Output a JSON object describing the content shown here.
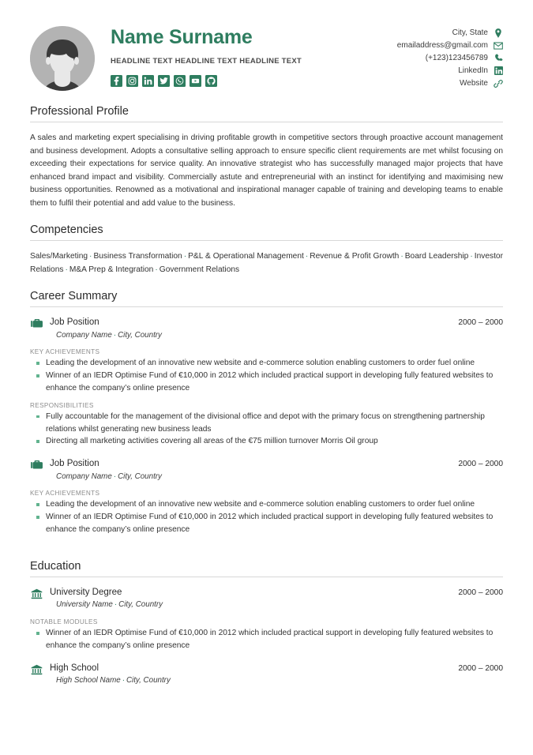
{
  "header": {
    "name": "Name Surname",
    "headline": "HEADLINE TEXT HEADLINE TEXT HEADLINE TEXT",
    "avatar_alt": "profile-photo-placeholder",
    "accent_color": "#2e7d5f",
    "socials": [
      {
        "name": "facebook-icon",
        "label": "Facebook"
      },
      {
        "name": "instagram-icon",
        "label": "Instagram"
      },
      {
        "name": "linkedin-icon",
        "label": "LinkedIn"
      },
      {
        "name": "twitter-icon",
        "label": "Twitter"
      },
      {
        "name": "whatsapp-icon",
        "label": "WhatsApp"
      },
      {
        "name": "youtube-icon",
        "label": "YouTube"
      },
      {
        "name": "github-icon",
        "label": "GitHub"
      }
    ],
    "contact": [
      {
        "text": "City, State",
        "icon": "map-pin-icon"
      },
      {
        "text": "emailaddress@gmail.com",
        "icon": "envelope-icon"
      },
      {
        "text": "(+123)123456789",
        "icon": "phone-icon"
      },
      {
        "text": "LinkedIn",
        "icon": "linkedin-icon"
      },
      {
        "text": "Website",
        "icon": "link-icon"
      }
    ]
  },
  "profile": {
    "title": "Professional Profile",
    "text": "A sales and marketing expert specialising in driving profitable growth in competitive sectors through proactive account management and business development. Adopts a consultative selling approach to ensure specific client requirements are met whilst focusing on exceeding their expectations for service quality. An innovative strategist who has successfully managed major projects that have enhanced brand impact and visibility. Commercially astute and entrepreneurial with an instinct for identifying and maximising new business opportunities. Renowned as a motivational and inspirational manager capable of training and developing teams to enable them to fulfil their potential and add value to the business."
  },
  "competencies": {
    "title": "Competencies",
    "items": [
      "Sales/Marketing",
      "Business Transformation",
      "P&L & Operational Management",
      "Revenue & Profit Growth",
      "Board Leadership",
      "Investor Relations",
      "M&A Prep & Integration",
      "Government Relations"
    ]
  },
  "career": {
    "title": "Career Summary",
    "entries": [
      {
        "position": "Job Position",
        "company": "Company Name",
        "location": "City, Country",
        "dates": "2000 – 2000",
        "groups": [
          {
            "label": "KEY ACHIEVEMENTS",
            "bullets": [
              "Leading the development of an innovative new website and e-commerce solution enabling customers to order fuel online",
              "Winner of an IEDR Optimise Fund of €10,000 in 2012 which included practical support in developing fully featured websites to enhance the company’s online presence"
            ]
          },
          {
            "label": "RESPONSIBILITIES",
            "bullets": [
              "Fully accountable for the management of the divisional office and depot with the primary focus on strengthening partnership relations whilst generating new business leads",
              "Directing all marketing activities covering all areas of the €75 million turnover Morris Oil group"
            ]
          }
        ]
      },
      {
        "position": "Job Position",
        "company": "Company Name",
        "location": "City, Country",
        "dates": "2000 – 2000",
        "groups": [
          {
            "label": "KEY ACHIEVEMENTS",
            "bullets": [
              "Leading the development of an innovative new website and e-commerce solution enabling customers to order fuel online",
              "Winner of an IEDR Optimise Fund of €10,000 in 2012 which included practical support in developing fully featured websites to enhance the company’s online presence"
            ]
          }
        ]
      }
    ]
  },
  "education": {
    "title": "Education",
    "entries": [
      {
        "degree": "University Degree",
        "institution": "University Name",
        "location": "City, Country",
        "dates": "2000 – 2000",
        "groups": [
          {
            "label": "NOTABLE MODULES",
            "bullets": [
              "Winner of an IEDR Optimise Fund of €10,000 in 2012 which included practical support in developing fully featured websites to enhance the company’s online presence"
            ]
          }
        ]
      },
      {
        "degree": "High School",
        "institution": "High School Name",
        "location": "City, Country",
        "dates": "2000 – 2000",
        "groups": []
      }
    ]
  }
}
